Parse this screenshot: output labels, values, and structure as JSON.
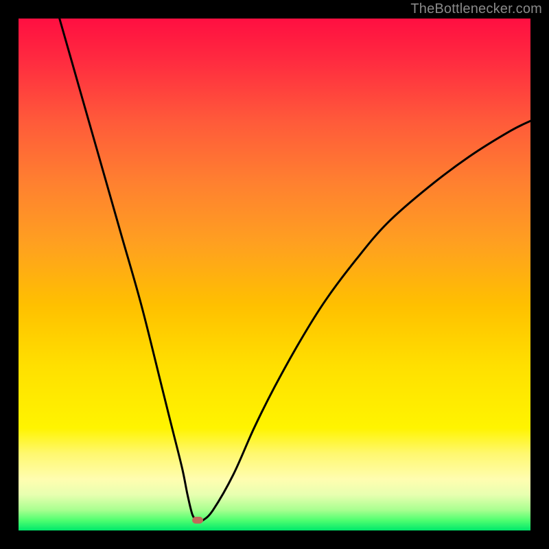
{
  "watermark": "TheBottlenecker.com",
  "chart_data": {
    "type": "line",
    "title": "",
    "xlabel": "",
    "ylabel": "",
    "xlim": [
      0,
      100
    ],
    "ylim": [
      0,
      100
    ],
    "marker": {
      "x": 35,
      "y": 2
    },
    "series": [
      {
        "name": "curve",
        "x": [
          8,
          12,
          16,
          20,
          24,
          28,
          30,
          32,
          33,
          34,
          35,
          36,
          38,
          42,
          46,
          50,
          55,
          60,
          66,
          72,
          80,
          88,
          96,
          100
        ],
        "y": [
          100,
          86,
          72,
          58,
          44,
          28,
          20,
          12,
          7,
          3,
          2,
          2,
          4,
          11,
          20,
          28,
          37,
          45,
          53,
          60,
          67,
          73,
          78,
          80
        ]
      }
    ],
    "gradient_colors": [
      "#ff0f41",
      "#ffa020",
      "#fff400",
      "#00e86b"
    ]
  }
}
